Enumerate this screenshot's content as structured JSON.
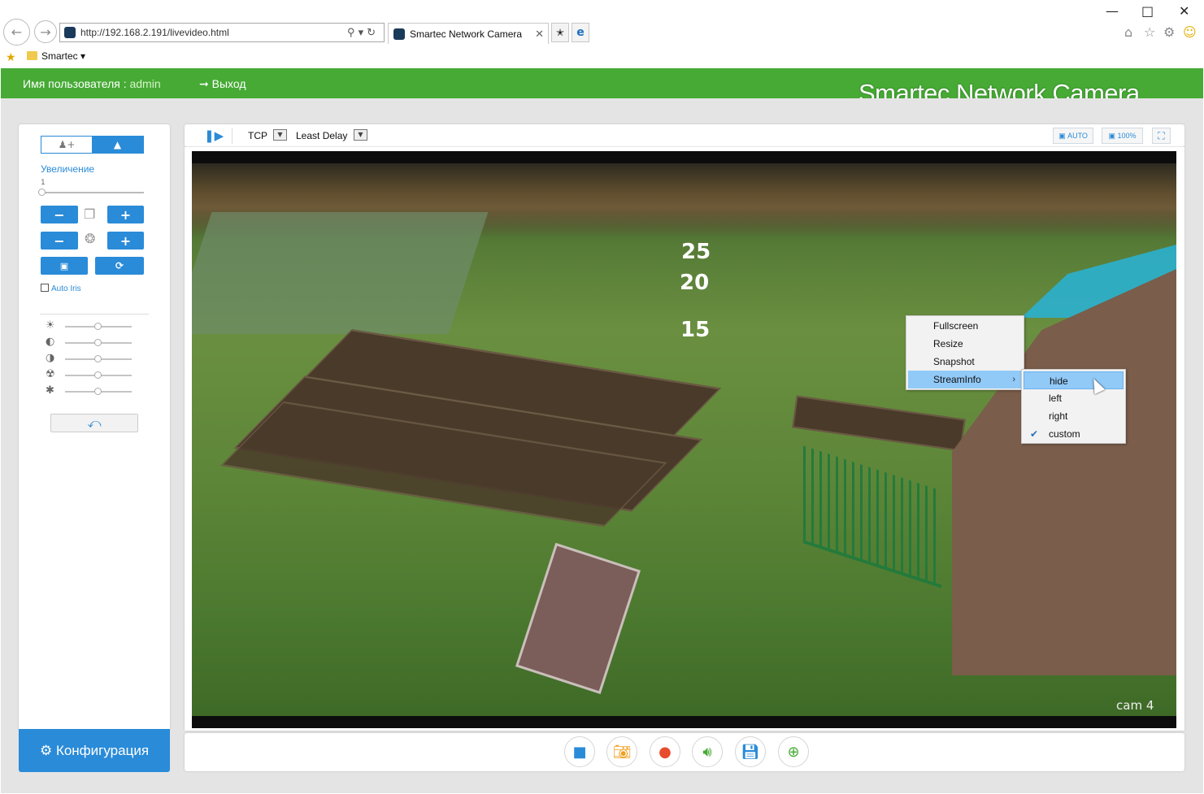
{
  "browser": {
    "url": "http://192.168.2.191/livevideo.html",
    "tab_title": "Smartec Network Camera",
    "favorites": {
      "folder": "Smartec"
    }
  },
  "header": {
    "user_label": "Имя пользователя : ",
    "username": "admin",
    "logout": "Выход",
    "brand": "Smartec Network Camera"
  },
  "ptz": {
    "zoom_label": "Увеличение",
    "zoom_value": "1",
    "auto_iris": "Auto Iris"
  },
  "config_button": "Конфигурация",
  "toolbar": {
    "protocol": "TCP",
    "delay": "Least Delay",
    "auto_label": "AUTO",
    "percent_label": "100%"
  },
  "video": {
    "osd_numbers": [
      "25",
      "20",
      "15"
    ],
    "camera_label": "cam 4"
  },
  "context_menu": {
    "items": [
      "Fullscreen",
      "Resize",
      "Snapshot",
      "StreamInfo"
    ],
    "submenu": [
      "hide",
      "left",
      "right",
      "custom"
    ]
  },
  "colors": {
    "header_green": "#46aa35",
    "accent_blue": "#2a8bd8"
  }
}
